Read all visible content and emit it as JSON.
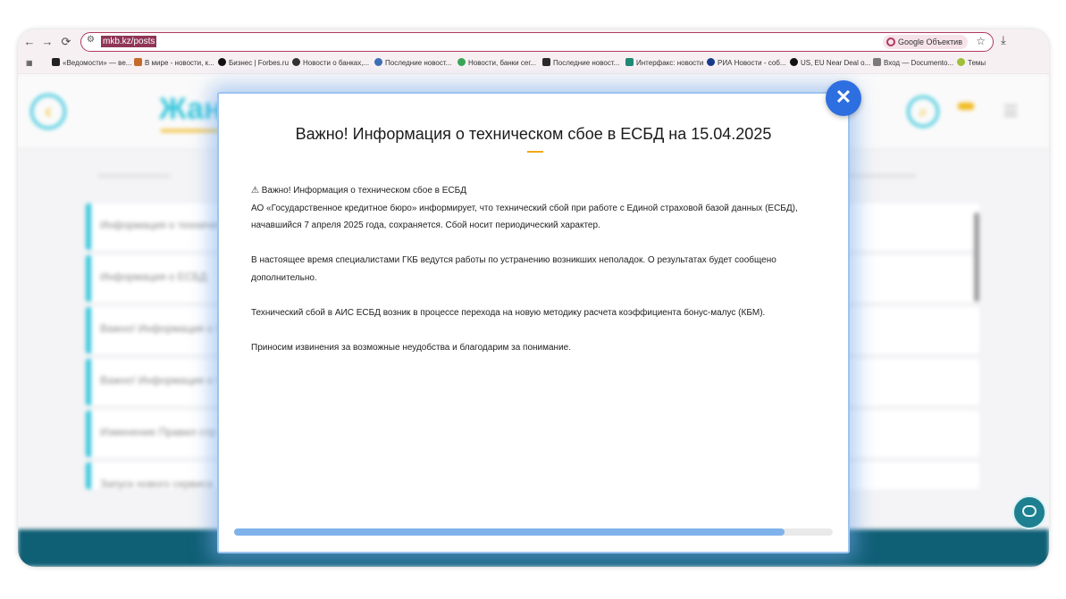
{
  "browser": {
    "url": "mkb.kz/posts",
    "lens_label": "Google Объектив",
    "nav": {
      "back_icon": "←",
      "forward_icon": "→",
      "reload_icon": "⟳",
      "star_icon": "☆",
      "download_icon": "⤓"
    },
    "bookmarks": [
      {
        "label": "«Ведомости» — ве...",
        "color": "#222222"
      },
      {
        "label": "В мире - новости, к...",
        "color": "#c56b2a"
      },
      {
        "label": "Бизнес | Forbes.ru",
        "color": "#111111"
      },
      {
        "label": "Новости о банках,...",
        "color": "#333333"
      },
      {
        "label": "Последние новост...",
        "color": "#3d6fb6"
      },
      {
        "label": "Новости, банки сег...",
        "color": "#3aa655"
      },
      {
        "label": "Последние новост...",
        "color": "#2b2b2b"
      },
      {
        "label": "Интерфакс: новости",
        "color": "#1f8a74"
      },
      {
        "label": "РИА Новости - соб...",
        "color": "#1a3a8a"
      },
      {
        "label": "US, EU Near Deal o...",
        "color": "#111111"
      },
      {
        "label": "Вход — Documento...",
        "color": "#7a7a7a"
      },
      {
        "label": "Темы",
        "color": "#9fbf3a"
      }
    ]
  },
  "site": {
    "logo_text": "Жанс",
    "rows": [
      "Информация о техничес",
      "Информация о ЕСБД",
      "Важно! Информация о т",
      "Важно! Информация о т",
      "Изменение Правил стр",
      "Запуск нового сервиса"
    ]
  },
  "modal": {
    "title": "Важно! Информация о техническом сбое в ЕСБД на 15.04.2025",
    "paragraphs": [
      "⚠ Важно! Информация о техническом сбое в ЕСБД",
      "АО «Государственное кредитное бюро» информирует, что технический сбой при работе с Единой страховой базой данных (ЕСБД), начавшийся 7 апреля 2025 года, сохраняется. Сбой носит периодический характер.",
      "В настоящее время специалистами ГКБ ведутся работы по устранению возникших неполадок. О результатах будет сообщено дополнительно.",
      "Технический сбой в АИС ЕСБД возник в процессе перехода на новую методику расчета коэффициента бонус-малус (КБМ).",
      "Приносим извинения за возможные неудобства и благодарим за понимание."
    ],
    "close_icon": "✕",
    "scroll_progress_percent": 92
  },
  "colors": {
    "accent": "#35c6dc",
    "brand_yellow": "#f1b81a",
    "close_button": "#2d6fe0",
    "footer": "#0f5f75"
  }
}
